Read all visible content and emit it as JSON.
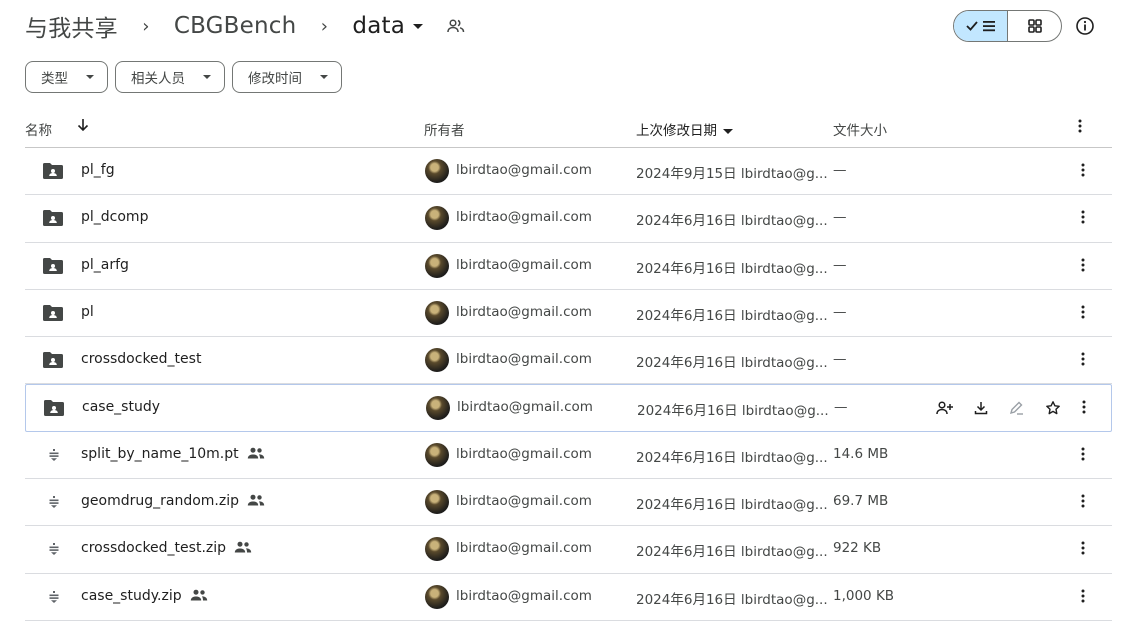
{
  "breadcrumb": {
    "root": "与我共享",
    "parent": "CBGBench",
    "current": "data"
  },
  "filters": [
    {
      "label": "类型"
    },
    {
      "label": "相关人员"
    },
    {
      "label": "修改时间"
    }
  ],
  "columns": {
    "name": "名称",
    "owner": "所有者",
    "modified": "上次修改日期",
    "size": "文件大小"
  },
  "rows": [
    {
      "name": "pl_fg",
      "type": "shared-folder",
      "owner": "lbirdtao@gmail.com",
      "modified": "2024年9月15日 lbirdtao@g...",
      "size": "—"
    },
    {
      "name": "pl_dcomp",
      "type": "shared-folder",
      "owner": "lbirdtao@gmail.com",
      "modified": "2024年6月16日 lbirdtao@g...",
      "size": "—"
    },
    {
      "name": "pl_arfg",
      "type": "shared-folder",
      "owner": "lbirdtao@gmail.com",
      "modified": "2024年6月16日 lbirdtao@g...",
      "size": "—"
    },
    {
      "name": "pl",
      "type": "shared-folder",
      "owner": "lbirdtao@gmail.com",
      "modified": "2024年6月16日 lbirdtao@g...",
      "size": "—"
    },
    {
      "name": "crossdocked_test",
      "type": "shared-folder",
      "owner": "lbirdtao@gmail.com",
      "modified": "2024年6月16日 lbirdtao@g...",
      "size": "—"
    },
    {
      "name": "case_study",
      "type": "shared-folder",
      "owner": "lbirdtao@gmail.com",
      "modified": "2024年6月16日 lbirdtao@g...",
      "size": "—",
      "selected": true
    },
    {
      "name": "split_by_name_10m.pt",
      "type": "archive-file",
      "owner": "lbirdtao@gmail.com",
      "modified": "2024年6月16日 lbirdtao@g...",
      "size": "14.6 MB"
    },
    {
      "name": "geomdrug_random.zip",
      "type": "archive-file",
      "owner": "lbirdtao@gmail.com",
      "modified": "2024年6月16日 lbirdtao@g...",
      "size": "69.7 MB"
    },
    {
      "name": "crossdocked_test.zip",
      "type": "archive-file",
      "owner": "lbirdtao@gmail.com",
      "modified": "2024年6月16日 lbirdtao@g...",
      "size": "922 KB"
    },
    {
      "name": "case_study.zip",
      "type": "archive-file",
      "owner": "lbirdtao@gmail.com",
      "modified": "2024年6月16日 lbirdtao@g...",
      "size": "1,000 KB"
    }
  ],
  "icons": {
    "view_list_active": "check-list-icon",
    "view_grid": "grid-icon",
    "info": "info-icon",
    "sort": "arrow-down-icon",
    "more": "more-vert-icon",
    "row_actions": [
      "share-person-add-icon",
      "download-icon",
      "rename-icon",
      "star-icon"
    ]
  },
  "colors": {
    "accent_bg": "#c2e7ff",
    "selected_border": "#b4c8eb",
    "text": "#1f1f1f",
    "muted": "#444746"
  }
}
